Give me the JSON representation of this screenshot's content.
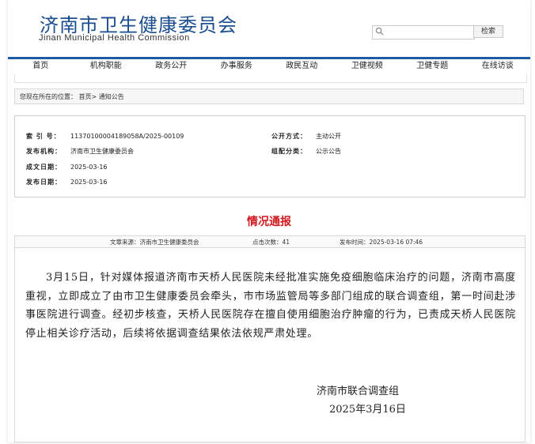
{
  "header": {
    "title": "济南市卫生健康委员会",
    "subtitle": "Jinan Municipal Health Commission",
    "search_placeholder": "",
    "search_button": "检索"
  },
  "nav": [
    "首页",
    "机构职能",
    "政务公开",
    "办事服务",
    "政民互动",
    "卫健视频",
    "卫健专题",
    "在线访谈"
  ],
  "breadcrumb": "您现在所在的位置： 首页> 通知公告",
  "meta": {
    "index_label": "索 引 号：",
    "index_value": "11370100004189058A/2025-00109",
    "publish_mode_label": "公开方式：",
    "publish_mode_value": "主动公开",
    "org_label": "发布机构：",
    "org_value": "济南市卫生健康委员会",
    "category_label": "组配分类：",
    "category_value": "公示公告",
    "created_label": "成文日期：",
    "created_value": "2025-03-16",
    "published_label": "发布日期：",
    "published_value": "2025-03-16"
  },
  "article": {
    "title": "情况通报",
    "source": "文章来源：济南市卫生健康委员会",
    "clicks": "点击次数：41",
    "time": "发布时间：2025-03-16 07:46",
    "body": "3月15日，针对媒体报道济南市天桥人民医院未经批准实施免疫细胞临床治疗的问题，济南市高度重视，立即成立了由市卫生健康委员会牵头，市市场监管局等多部门组成的联合调查组，第一时间赴涉事医院进行调查。经初步核查，天桥人民医院存在擅自使用细胞治疗肿瘤的行为，已责成天桥人民医院停止相关诊疗活动，后续将依据调查结果依法依规严肃处理。",
    "signature_org": "济南市联合调查组",
    "signature_date": "2025年3月16日"
  }
}
